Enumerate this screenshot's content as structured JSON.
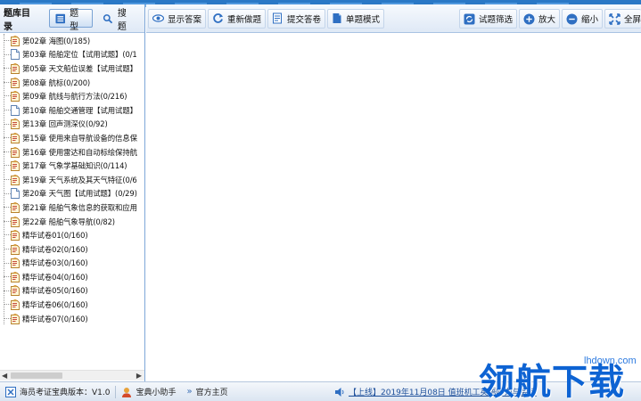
{
  "left_panel": {
    "title": "题库目录",
    "tabs": [
      {
        "label": "题型",
        "active": true
      },
      {
        "label": "搜题",
        "active": false
      }
    ]
  },
  "tree": {
    "items": [
      {
        "label": "第02章 海图(0/185)",
        "icon": "exam-doc-icon"
      },
      {
        "label": "第03章 船舶定位【试用试题】(0/1",
        "icon": "blank-doc-icon"
      },
      {
        "label": "第05章 天文船位误差【试用试题】",
        "icon": "exam-doc-icon"
      },
      {
        "label": "第08章 航标(0/200)",
        "icon": "exam-doc-icon"
      },
      {
        "label": "第09章 航线与航行方法(0/216)",
        "icon": "exam-doc-icon"
      },
      {
        "label": "第10章 船舶交通管理【试用试题】",
        "icon": "blank-doc-icon"
      },
      {
        "label": "第13章 回声测深仪(0/92)",
        "icon": "exam-doc-icon"
      },
      {
        "label": "第15章 使用来自导航设备的信息保",
        "icon": "exam-doc-icon"
      },
      {
        "label": "第16章 使用雷达和自动标绘保持航",
        "icon": "exam-doc-icon"
      },
      {
        "label": "第17章 气象学基础知识(0/114)",
        "icon": "exam-doc-icon"
      },
      {
        "label": "第19章 天气系统及其天气特征(0/6",
        "icon": "exam-doc-icon"
      },
      {
        "label": "第20章 天气图【试用试题】(0/29)",
        "icon": "blank-doc-icon"
      },
      {
        "label": "第21章 船舶气象信息的获取和应用",
        "icon": "exam-doc-icon"
      },
      {
        "label": "第22章 船舶气象导航(0/82)",
        "icon": "exam-doc-icon"
      },
      {
        "label": "精华试卷01(0/160)",
        "icon": "exam-doc-icon"
      },
      {
        "label": "精华试卷02(0/160)",
        "icon": "exam-doc-icon"
      },
      {
        "label": "精华试卷03(0/160)",
        "icon": "exam-doc-icon"
      },
      {
        "label": "精华试卷04(0/160)",
        "icon": "exam-doc-icon"
      },
      {
        "label": "精华试卷05(0/160)",
        "icon": "exam-doc-icon"
      },
      {
        "label": "精华试卷06(0/160)",
        "icon": "exam-doc-icon"
      },
      {
        "label": "精华试卷07(0/160)",
        "icon": "exam-doc-icon"
      }
    ]
  },
  "toolbar": {
    "show_answer": "显示答案",
    "redo": "重新做题",
    "submit": "提交答卷",
    "single_mode": "单题模式",
    "filter": "试题筛选",
    "zoom_in": "放大",
    "zoom_out": "缩小",
    "fullscreen": "全屏"
  },
  "status_bar": {
    "version": "海员考证宝典版本：V1.0",
    "assistant": "宝典小助手",
    "homepage": "官方主页",
    "notice": "【上线】2019年11月08日 值班机工英语听力与会话"
  },
  "watermark": {
    "url": "lhdown.com",
    "text": "领航下载"
  },
  "colors": {
    "accent": "#2a78c6",
    "toolbar_bg": "#dfe9f6",
    "watermark": "#0d63d3"
  }
}
